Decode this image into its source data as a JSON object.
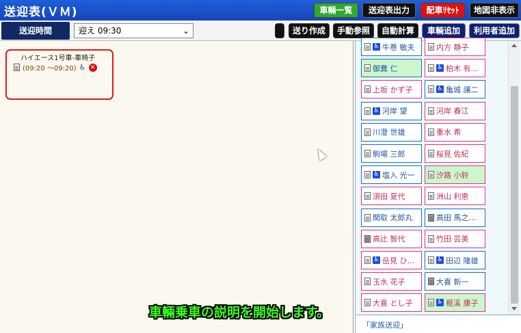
{
  "header": {
    "title": "送迎表(ＶＭ)",
    "buttons": {
      "vehicle_list": "車輛一覧",
      "output": "送迎表出力",
      "reset": "配車ﾘｾｯﾄ",
      "hide_map": "地図非表示"
    }
  },
  "toolbar": {
    "time_label": "送迎時間",
    "time_select": "迎え 09:30",
    "blank_button": "",
    "send_create": "送り作成",
    "manual_ref": "手動参照",
    "auto_calc": "自動計算",
    "add_vehicle": "車輛追加",
    "add_user": "利用者追加"
  },
  "vehicle": {
    "name": "ハイエース1号車-車椅子",
    "time_range": "(09:20 ～09:20)"
  },
  "users": [
    {
      "name": "牛巻 敏夫",
      "color": "blue",
      "wheelchair": true,
      "photo": false,
      "green": false
    },
    {
      "name": "内方 静子",
      "color": "pink",
      "wheelchair": false,
      "photo": false,
      "green": false
    },
    {
      "name": "御糞 仁",
      "color": "blue",
      "wheelchair": false,
      "photo": false,
      "green": true
    },
    {
      "name": "柏木 有希…",
      "color": "pink",
      "wheelchair": true,
      "photo": false,
      "green": false
    },
    {
      "name": "上坂 かず子",
      "color": "pink",
      "wheelchair": false,
      "photo": false,
      "green": false
    },
    {
      "name": "亀城 讓二",
      "color": "blue",
      "wheelchair": true,
      "photo": false,
      "green": false
    },
    {
      "name": "河岸 望",
      "color": "blue",
      "wheelchair": true,
      "photo": false,
      "green": false
    },
    {
      "name": "河岸 春江",
      "color": "pink",
      "wheelchair": false,
      "photo": false,
      "green": false
    },
    {
      "name": "川澄 世雄",
      "color": "blue",
      "wheelchair": false,
      "photo": false,
      "green": false
    },
    {
      "name": "重水 希",
      "color": "pink",
      "wheelchair": false,
      "photo": false,
      "green": false
    },
    {
      "name": "駒場 三郎",
      "color": "blue",
      "wheelchair": false,
      "photo": false,
      "green": false
    },
    {
      "name": "桜見 佐紀",
      "color": "pink",
      "wheelchair": false,
      "photo": false,
      "green": false
    },
    {
      "name": "塩入 光一",
      "color": "blue",
      "wheelchair": true,
      "photo": false,
      "green": false
    },
    {
      "name": "汐路 小鈴",
      "color": "pink",
      "wheelchair": false,
      "photo": false,
      "green": true
    },
    {
      "name": "須田 夏代",
      "color": "pink",
      "wheelchair": false,
      "photo": false,
      "green": false
    },
    {
      "name": "洲山 利恵",
      "color": "pink",
      "wheelchair": false,
      "photo": false,
      "green": false
    },
    {
      "name": "関取 太郎丸",
      "color": "blue",
      "wheelchair": false,
      "photo": false,
      "green": false
    },
    {
      "name": "高田 馬之…",
      "color": "blue",
      "wheelchair": false,
      "photo": true,
      "green": false
    },
    {
      "name": "高辻 智代",
      "color": "pink",
      "wheelchair": false,
      "photo": true,
      "green": false
    },
    {
      "name": "竹田 芸美",
      "color": "pink",
      "wheelchair": false,
      "photo": false,
      "green": false
    },
    {
      "name": "岳見 ひろ…",
      "color": "pink",
      "wheelchair": true,
      "photo": false,
      "green": false
    },
    {
      "name": "田辺 隆雄",
      "color": "blue",
      "wheelchair": true,
      "photo": false,
      "green": false
    },
    {
      "name": "玉水 花子",
      "color": "pink",
      "wheelchair": false,
      "photo": false,
      "green": false
    },
    {
      "name": "大喜 新一",
      "color": "blue",
      "wheelchair": false,
      "photo": true,
      "green": false
    },
    {
      "name": "大喜 とし子",
      "color": "pink",
      "wheelchair": false,
      "photo": false,
      "green": false
    },
    {
      "name": "榧溪 康子",
      "color": "pink",
      "wheelchair": true,
      "photo": false,
      "green": true
    }
  ],
  "family_label": "「家族送迎」",
  "caption": "車輛乗車の説明を開始します。"
}
